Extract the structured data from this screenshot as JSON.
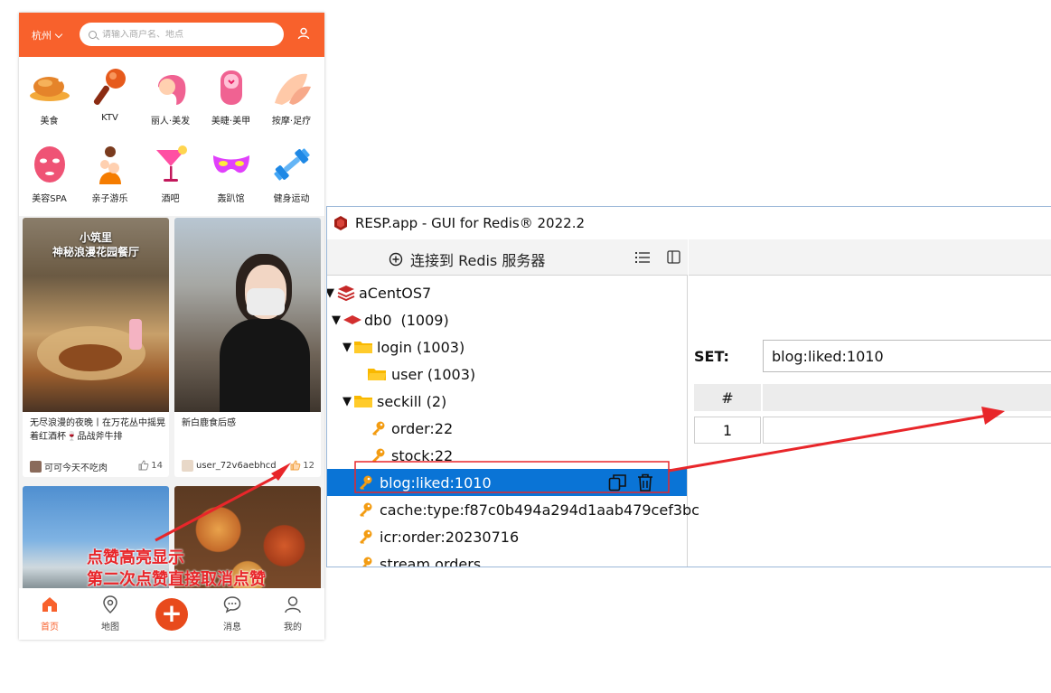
{
  "phone": {
    "city": "杭州",
    "search_placeholder": "请输入商户名、地点",
    "categories": [
      {
        "label": "美食",
        "icon": "roast-chicken-icon"
      },
      {
        "label": "KTV",
        "icon": "microphone-icon"
      },
      {
        "label": "丽人·美发",
        "icon": "hair-salon-icon"
      },
      {
        "label": "美睫·美甲",
        "icon": "nail-icon"
      },
      {
        "label": "按摩·足疗",
        "icon": "massage-icon"
      },
      {
        "label": "美容SPA",
        "icon": "face-mask-icon"
      },
      {
        "label": "亲子游乐",
        "icon": "family-icon"
      },
      {
        "label": "酒吧",
        "icon": "cocktail-icon"
      },
      {
        "label": "轰趴馆",
        "icon": "party-mask-icon"
      },
      {
        "label": "健身运动",
        "icon": "dumbbell-icon"
      }
    ],
    "cards": [
      {
        "overlay_line1": "小筑里",
        "overlay_line2": "神秘浪漫花园餐厅",
        "title": "无尽浪漫的夜晚丨在万花丛中摇晃着红酒杯🍷品战斧牛排",
        "author": "可可今天不吃肉",
        "likes": "14"
      },
      {
        "title": "新白鹿食后感",
        "author": "user_72v6aebhcd",
        "likes": "12"
      }
    ],
    "tabs": [
      {
        "label": "首页",
        "icon": "home-icon"
      },
      {
        "label": "地图",
        "icon": "map-pin-icon"
      },
      {
        "label": "消息",
        "icon": "message-icon"
      },
      {
        "label": "我的",
        "icon": "profile-icon"
      }
    ],
    "plus_label": "+"
  },
  "resp": {
    "title": "RESP.app - GUI for Redis® 2022.2",
    "connect_label": "连接到 Redis 服务器",
    "tree": {
      "server": "aCentOS7",
      "db": "db0",
      "db_count": "(1009)",
      "folders": [
        {
          "name": "login",
          "count": "(1003)"
        },
        {
          "name": "user",
          "count": "(1003)"
        },
        {
          "name": "seckill",
          "count": "(2)"
        }
      ],
      "keys": [
        "order:22",
        "stock:22",
        "blog:liked:1010",
        "cache:type:f87c0b494a294d1aab479cef3bc",
        "icr:order:20230716",
        "stream.orders"
      ]
    },
    "detail": {
      "type_label": "SET:",
      "key_name": "blog:liked:1010",
      "col_header": "#",
      "rows": [
        {
          "index": "1",
          "value": ""
        }
      ]
    }
  },
  "annotation": {
    "line1": "点赞高亮显示",
    "line2": "第二次点赞直接取消点赞",
    "color": "#e8262a"
  }
}
